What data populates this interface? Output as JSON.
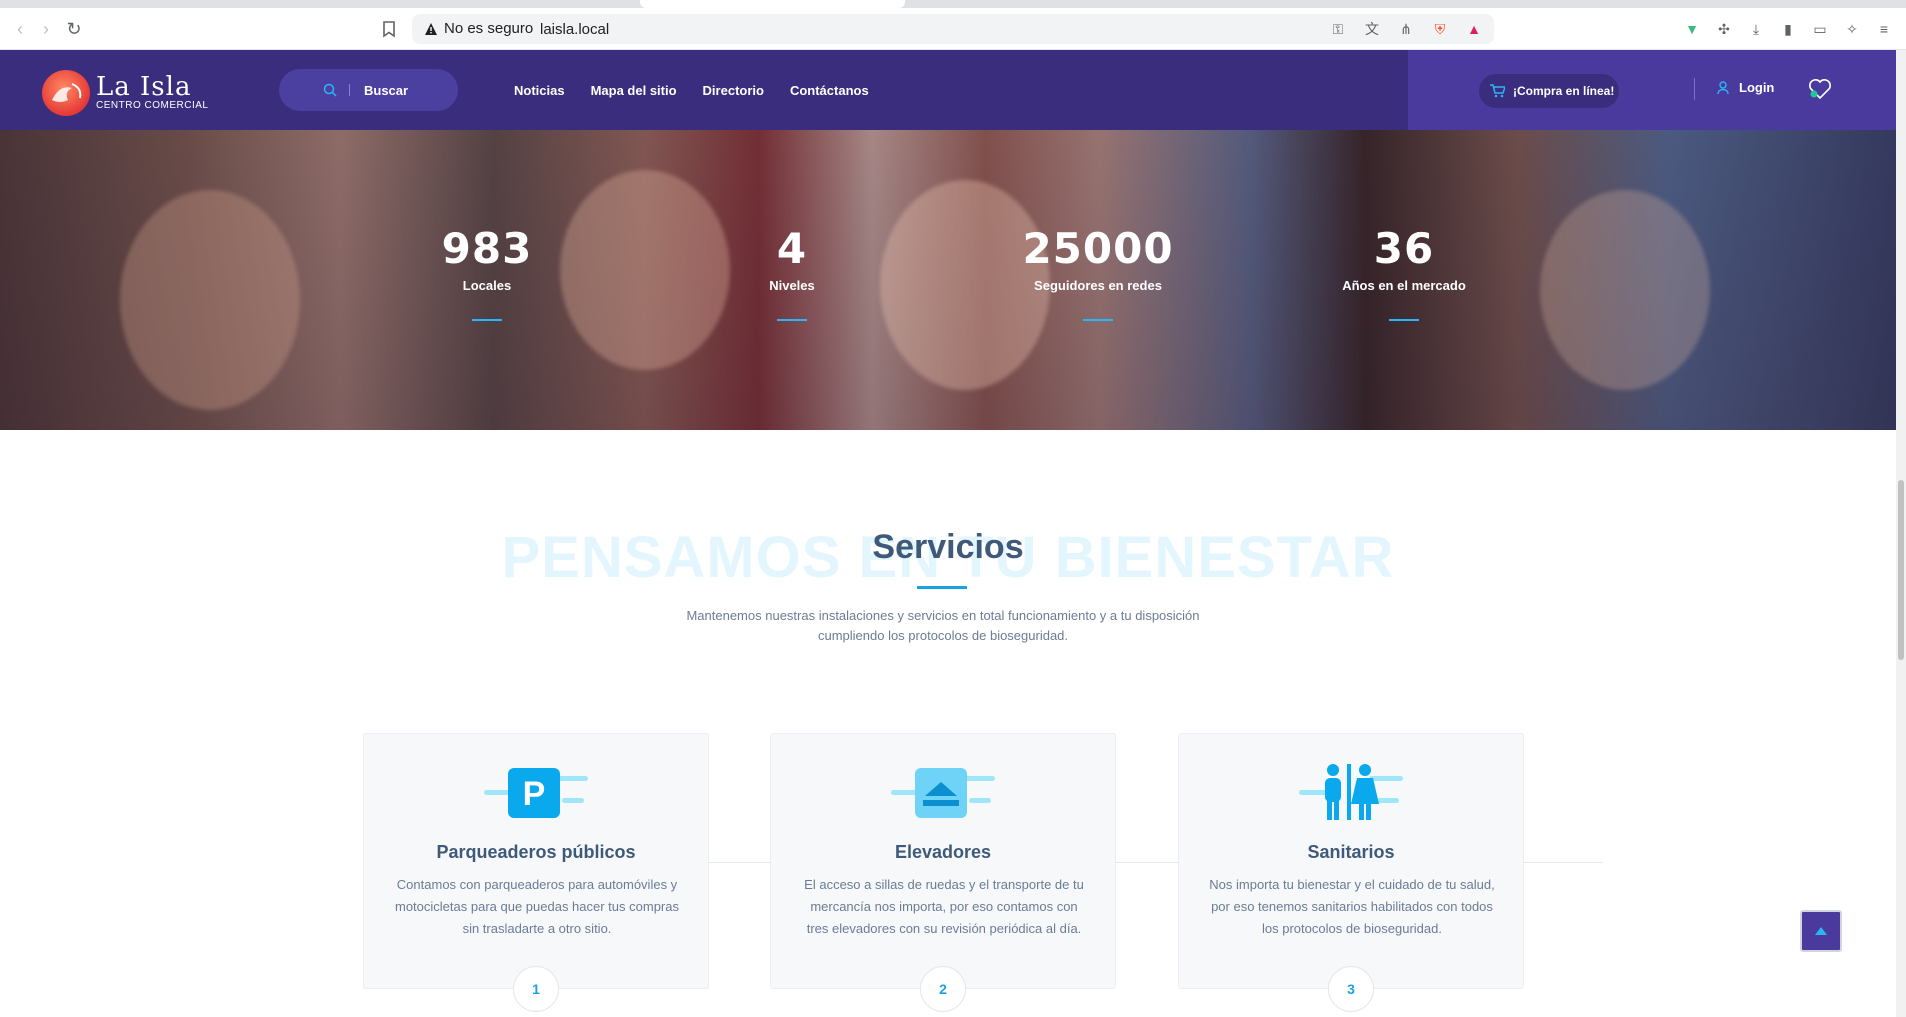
{
  "browser": {
    "security_label": "No es seguro",
    "url": "laisla.local"
  },
  "header": {
    "logo_title": "La Isla",
    "logo_subtitle": "CENTRO COMERCIAL",
    "search_label": "Buscar",
    "nav": [
      "Noticias",
      "Mapa del sitio",
      "Directorio",
      "Contáctanos"
    ],
    "shop_label": "¡Compra en línea!",
    "login_label": "Login"
  },
  "stats": [
    {
      "value": "983",
      "label": "Locales"
    },
    {
      "value": "4",
      "label": "Niveles"
    },
    {
      "value": "25000",
      "label": "Seguidores en redes"
    },
    {
      "value": "36",
      "label": "Años en el mercado"
    }
  ],
  "services": {
    "watermark": "PENSAMOS EN TU BIENESTAR",
    "title": "Servicios",
    "description": "Mantenemos nuestras instalaciones y servicios en total funcionamiento y a tu disposición cumpliendo los protocolos de bioseguridad.",
    "cards": [
      {
        "title": "Parqueaderos públicos",
        "text": "Contamos con parqueaderos para automóviles y motocicletas para que puedas hacer tus compras sin trasladarte a otro sitio.",
        "number": "1",
        "icon": "parking-icon"
      },
      {
        "title": "Elevadores",
        "text": "El acceso a sillas de ruedas y el transporte de tu mercancía nos importa, por eso contamos con tres elevadores con su revisión periódica al día.",
        "number": "2",
        "icon": "elevator-icon"
      },
      {
        "title": "Sanitarios",
        "text": "Nos importa tu bienestar y el cuidado de tu salud, por eso tenemos sanitarios habilitados con todos los protocolos de bioseguridad.",
        "number": "3",
        "icon": "restroom-icon"
      }
    ]
  },
  "colors": {
    "header_bg": "#3a2d7d",
    "accent": "#1ba1e2",
    "title": "#3f5a78"
  }
}
